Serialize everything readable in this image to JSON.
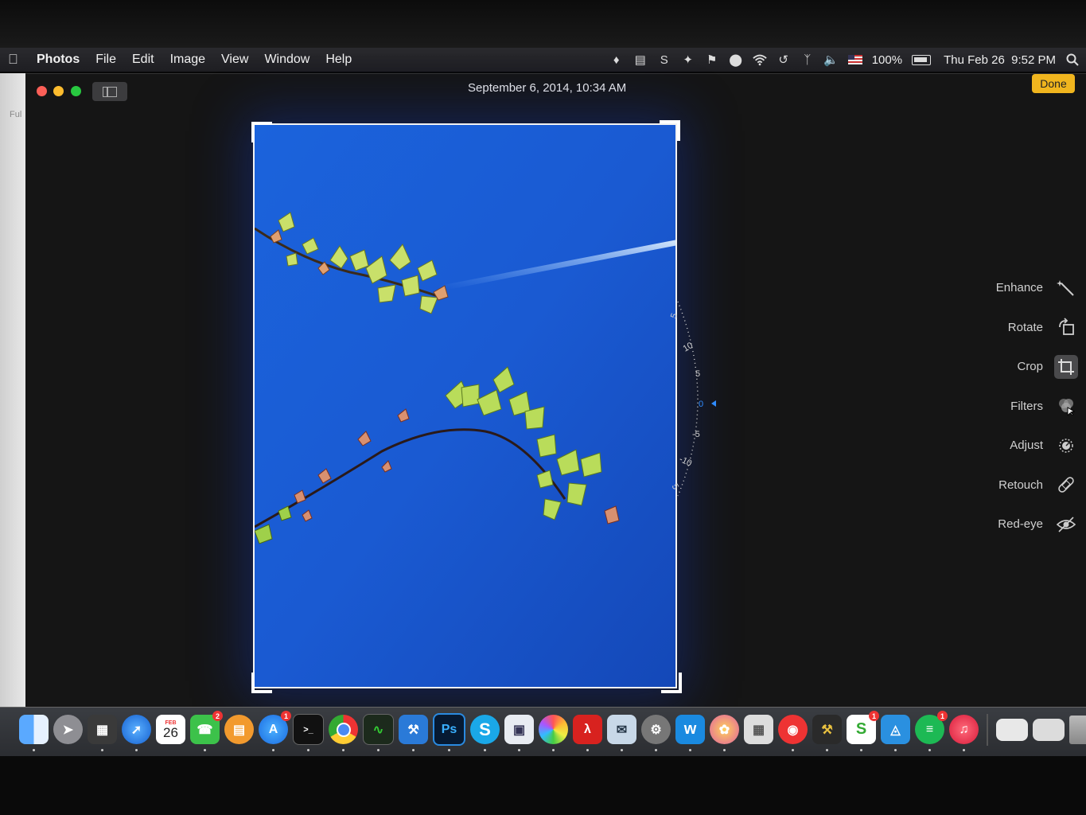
{
  "menubar": {
    "app_name": "Photos",
    "items": [
      "File",
      "Edit",
      "Image",
      "View",
      "Window",
      "Help"
    ],
    "battery": "100%",
    "clock": "Thu Feb 26  9:52 PM"
  },
  "window": {
    "title": "September 6, 2014, 10:34 AM",
    "done_label": "Done",
    "sidebar_peek": "Ful"
  },
  "straighten_dial": {
    "ticks": [
      "5",
      "10",
      "5",
      "0",
      "-5",
      "-10",
      "5"
    ],
    "current": "0"
  },
  "tools": [
    {
      "label": "Enhance",
      "icon": "magic-wand-icon"
    },
    {
      "label": "Rotate",
      "icon": "rotate-icon"
    },
    {
      "label": "Crop",
      "icon": "crop-icon",
      "active": true
    },
    {
      "label": "Filters",
      "icon": "filters-icon"
    },
    {
      "label": "Adjust",
      "icon": "adjust-icon"
    },
    {
      "label": "Retouch",
      "icon": "bandage-icon"
    },
    {
      "label": "Red-eye",
      "icon": "red-eye-icon"
    }
  ],
  "dock": {
    "calendar_month": "FEB",
    "calendar_day": "26",
    "facetime_badge": "2",
    "appstore_badge": "1",
    "skype_badge": "1",
    "spotify_badge": "1",
    "photoshop_label": "Ps"
  },
  "colors": {
    "sky": "#1a5fd6",
    "done_button": "#f0b51e",
    "dial_accent": "#2f8cff"
  }
}
